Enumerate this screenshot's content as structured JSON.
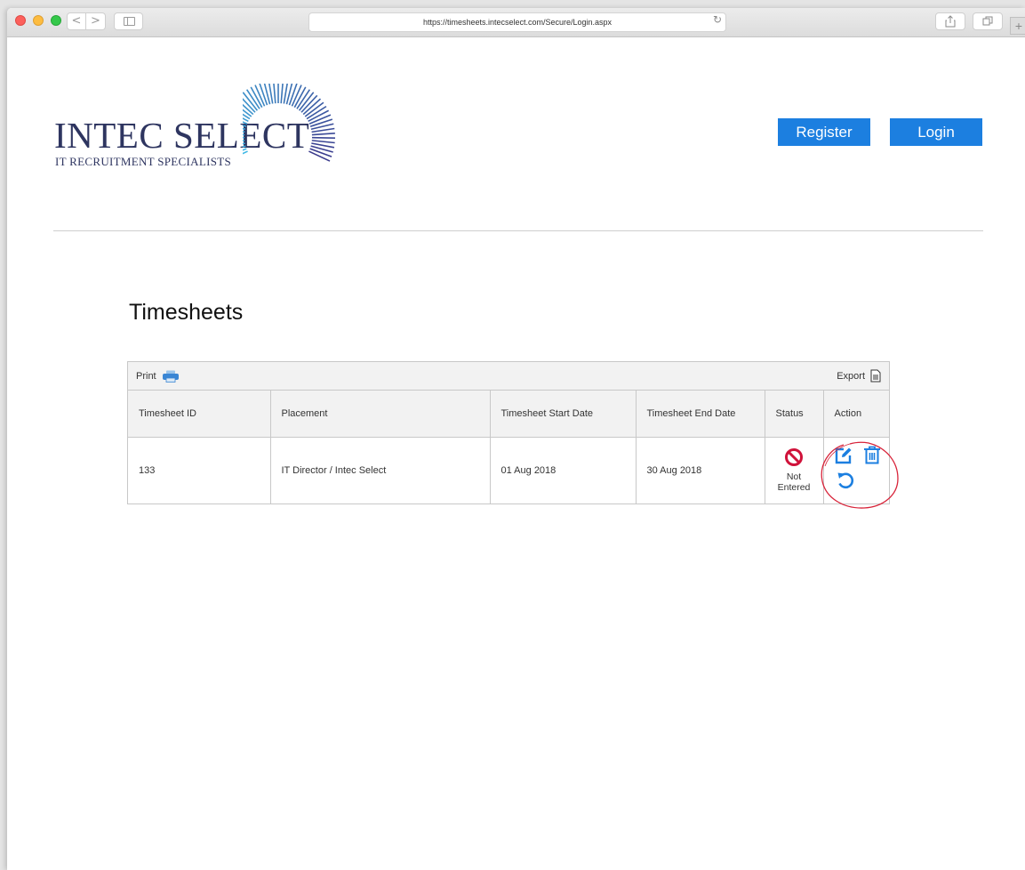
{
  "browser": {
    "url": "https://timesheets.intecselect.com/Secure/Login.aspx",
    "nav_back": "<",
    "nav_forward": ">",
    "new_tab": "+"
  },
  "brand": {
    "name": "INTEC SELECT",
    "tagline": "IT RECRUITMENT SPECIALISTS",
    "colors": {
      "navy": "#2e3560",
      "arc_light": "#3fb8e6",
      "arc_dark": "#3a3a8c"
    }
  },
  "header": {
    "register_label": "Register",
    "login_label": "Login",
    "button_color": "#1c7fe0"
  },
  "page": {
    "title": "Timesheets"
  },
  "grid": {
    "print_label": "Print",
    "export_label": "Export",
    "columns": [
      "Timesheet ID",
      "Placement",
      "Timesheet Start Date",
      "Timesheet End Date",
      "Status",
      "Action"
    ],
    "rows": [
      {
        "id": "133",
        "placement": "IT Director / Intec Select",
        "start": "01 Aug 2018",
        "end": "30 Aug 2018",
        "status": "Not Entered",
        "status_icon": "blocked-icon",
        "actions": [
          "edit-icon",
          "delete-icon",
          "undo-icon"
        ]
      }
    ]
  },
  "colors": {
    "status_red": "#d0123a",
    "action_blue": "#1c7fe0",
    "annotation_red": "#d8243a"
  }
}
